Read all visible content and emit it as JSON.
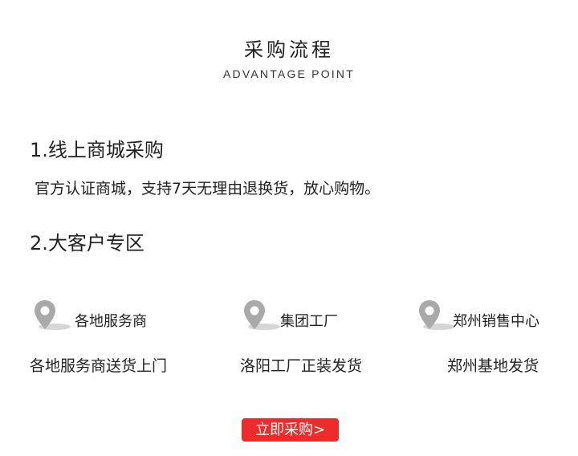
{
  "header": {
    "title": "采购流程",
    "subtitle": "ADVANTAGE POINT"
  },
  "section1": {
    "heading": "1.线上商城采购",
    "description": "官方认证商城，支持7天无理由退换货，放心购物。"
  },
  "section2": {
    "heading": "2.大客户专区",
    "items": [
      {
        "icon": "location-pin-icon",
        "label": "各地服务商",
        "text": "各地服务商送货上门"
      },
      {
        "icon": "location-pin-icon",
        "label": "集团工厂",
        "text": "洛阳工厂正装发货"
      },
      {
        "icon": "location-pin-icon",
        "label": "郑州销售中心",
        "text": "郑州基地发货"
      }
    ]
  },
  "cta": {
    "label": "立即采购>"
  },
  "colors": {
    "accent": "#ee2b2b",
    "pin": "#a9a9a9",
    "text": "#222222"
  }
}
